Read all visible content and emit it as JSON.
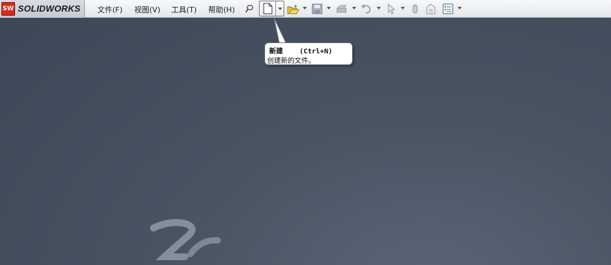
{
  "app": {
    "name": "SOLIDWORKS",
    "badge": "SW"
  },
  "menu": [
    {
      "label": "文件(F)"
    },
    {
      "label": "视图(V)"
    },
    {
      "label": "工具(T)"
    },
    {
      "label": "帮助(H)"
    }
  ],
  "toolbar": {
    "icons": [
      "pushpin-icon",
      "new-document-icon",
      "open-folder-icon",
      "save-icon",
      "print-icon",
      "undo-icon",
      "select-icon",
      "rebuild-icon",
      "file-properties-icon",
      "options-icon"
    ]
  },
  "tooltip": {
    "title": "新建    (Ctrl+N)",
    "description": "创建新的文件。"
  },
  "colors": {
    "background_top": "#3c4656",
    "background_bottom": "#5a6676",
    "logo_red": "#d22b1f"
  }
}
